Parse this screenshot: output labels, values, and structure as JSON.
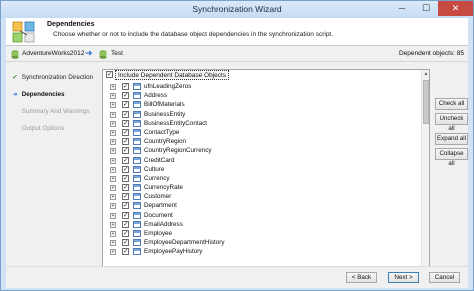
{
  "window": {
    "title": "Synchronization Wizard",
    "minimize": "─",
    "maximize": "☐",
    "close": "✕"
  },
  "header": {
    "title": "Dependencies",
    "subtitle": "Choose whether or not to include the database object dependencies in the synchronization script."
  },
  "dbbar": {
    "source": "AdventureWorks2012",
    "target": "Test",
    "dependent_count": "Dependent objects: 85"
  },
  "steps": [
    {
      "label": "Synchronization Direction",
      "state": "done",
      "marker": "✔"
    },
    {
      "label": "Dependencies",
      "state": "active",
      "marker": "➜"
    },
    {
      "label": "Summary And Warnings",
      "state": "pending",
      "marker": ""
    },
    {
      "label": "Output Options",
      "state": "pending",
      "marker": ""
    }
  ],
  "grid": {
    "header_label": "Include Dependent Database Objects",
    "rows": [
      {
        "name": "ufnLeadingZeros"
      },
      {
        "name": "Address"
      },
      {
        "name": "BillOfMaterials"
      },
      {
        "name": "BusinessEntity"
      },
      {
        "name": "BusinessEntityContact"
      },
      {
        "name": "ContactType"
      },
      {
        "name": "CountryRegion"
      },
      {
        "name": "CountryRegionCurrency"
      },
      {
        "name": "CreditCard"
      },
      {
        "name": "Culture"
      },
      {
        "name": "Currency"
      },
      {
        "name": "CurrencyRate"
      },
      {
        "name": "Customer"
      },
      {
        "name": "Department"
      },
      {
        "name": "Document"
      },
      {
        "name": "EmailAddress"
      },
      {
        "name": "Employee"
      },
      {
        "name": "EmployeeDepartmentHistory"
      },
      {
        "name": "EmployeePayHistory"
      }
    ]
  },
  "buttons": {
    "check_all": "Check all",
    "uncheck_all": "Uncheck all",
    "expand_all": "Expand all",
    "collapse_all": "Collapse all",
    "back": "< Back",
    "next": "Next >",
    "cancel": "Cancel"
  },
  "colors": {
    "window_frame": "#cfe2f6",
    "close_button": "#c74a43",
    "accent": "#2a6fd0"
  }
}
